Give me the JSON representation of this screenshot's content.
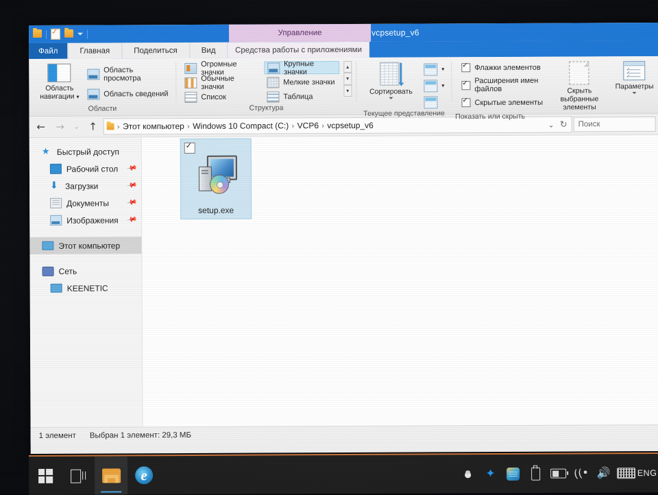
{
  "window": {
    "title": "vcpsetup_v6",
    "contextual_tab_title": "Управление",
    "quick_access": {
      "folder": "folder-icon",
      "properties": "properties-icon",
      "new_folder": "new-folder-icon",
      "customize": "customize-dropdown"
    }
  },
  "tabs": [
    {
      "label": "Файл",
      "selected": false
    },
    {
      "label": "Главная",
      "selected": false
    },
    {
      "label": "Поделиться",
      "selected": false
    },
    {
      "label": "Вид",
      "selected": true
    },
    {
      "label": "Средства работы с приложениями",
      "selected": false
    }
  ],
  "ribbon": {
    "groups": [
      {
        "label": "Области"
      },
      {
        "label": "Структура"
      },
      {
        "label": "Текущее представление"
      },
      {
        "label": "Показать или скрыть"
      }
    ],
    "panes": {
      "navigation_pane": "Область\nнавигации",
      "navigation_pane_line1": "Область",
      "navigation_pane_line2": "навигации",
      "preview_pane": "Область просмотра",
      "details_pane": "Область сведений"
    },
    "layout": {
      "extra_large_icons": "Огромные значки",
      "medium_icons": "Обычные значки",
      "list": "Список",
      "large_icons": "Крупные значки",
      "small_icons": "Мелкие значки",
      "details": "Таблица",
      "selected": "Крупные значки"
    },
    "current_view": {
      "sort_by": "Сортировать",
      "add_columns": "add-columns-icon",
      "size_columns": "size-columns-icon",
      "size_all_columns": "size-all-columns-icon"
    },
    "show_hide": {
      "item_checkboxes": {
        "label": "Флажки элементов",
        "checked": true
      },
      "file_extensions": {
        "label": "Расширения имен файлов",
        "checked": true
      },
      "hidden_items": {
        "label": "Скрытые элементы",
        "checked": true
      },
      "hide_selected_line1": "Скрыть выбранные",
      "hide_selected_line2": "элементы",
      "options": "Параметры"
    }
  },
  "address_bar": {
    "back": "back-arrow",
    "forward": "forward-arrow",
    "recent": "recent-locations-chevron",
    "up": "up-arrow",
    "refresh": "refresh-icon",
    "dropdown": "address-dropdown-chevron",
    "breadcrumbs": [
      "Этот компьютер",
      "Windows 10 Compact (C:)",
      "VCP6",
      "vcpsetup_v6"
    ],
    "separator": "›",
    "search_placeholder": "Поиск"
  },
  "sidebar": {
    "items": [
      {
        "label": "Быстрый доступ",
        "icon": "star-icon",
        "pinned": false,
        "selected": false,
        "indent": false
      },
      {
        "label": "Рабочий стол",
        "icon": "desktop-icon",
        "pinned": true,
        "selected": false,
        "indent": true
      },
      {
        "label": "Загрузки",
        "icon": "downloads-icon",
        "pinned": true,
        "selected": false,
        "indent": true
      },
      {
        "label": "Документы",
        "icon": "documents-icon",
        "pinned": true,
        "selected": false,
        "indent": true
      },
      {
        "label": "Изображения",
        "icon": "pictures-icon",
        "pinned": true,
        "selected": false,
        "indent": true
      },
      {
        "label": "Этот компьютер",
        "icon": "this-pc-icon",
        "pinned": false,
        "selected": true,
        "indent": false
      },
      {
        "label": "Сеть",
        "icon": "network-icon",
        "pinned": false,
        "selected": false,
        "indent": false
      },
      {
        "label": "KEENETIC",
        "icon": "network-computer-icon",
        "pinned": false,
        "selected": false,
        "indent": true
      }
    ],
    "pin_glyph": "📌"
  },
  "file_list": {
    "items": [
      {
        "name": "setup.exe",
        "icon": "setup-installer-icon",
        "selected": true,
        "checked": true
      }
    ]
  },
  "status_bar": {
    "item_count": "1 элемент",
    "selection": "Выбран 1 элемент: 29,3 МБ"
  },
  "taskbar": {
    "start": "windows-start-icon",
    "task_view": "task-view-icon",
    "file_explorer": {
      "icon": "file-explorer-icon",
      "active": true
    },
    "internet_explorer": {
      "icon": "internet-explorer-icon",
      "glyph": "e",
      "active": false
    },
    "tray": [
      {
        "name": "show-hidden-icons-chevron"
      },
      {
        "name": "bluetooth-icon",
        "glyph": "✦"
      },
      {
        "name": "tray-app-icon"
      },
      {
        "name": "usb-safely-remove-icon"
      },
      {
        "name": "battery-icon"
      },
      {
        "name": "wifi-icon",
        "glyph": "(("
      },
      {
        "name": "volume-icon",
        "glyph": "🔊"
      },
      {
        "name": "keyboard-icon"
      }
    ],
    "language": "ENG"
  },
  "colors": {
    "title_blue": "#1e78d7",
    "contextual_purple": "#e5c9e8",
    "selection_blue": "#cde4f2",
    "taskbar_dark": "#1d1d1d",
    "taskbar_accent": "#c9723a"
  }
}
